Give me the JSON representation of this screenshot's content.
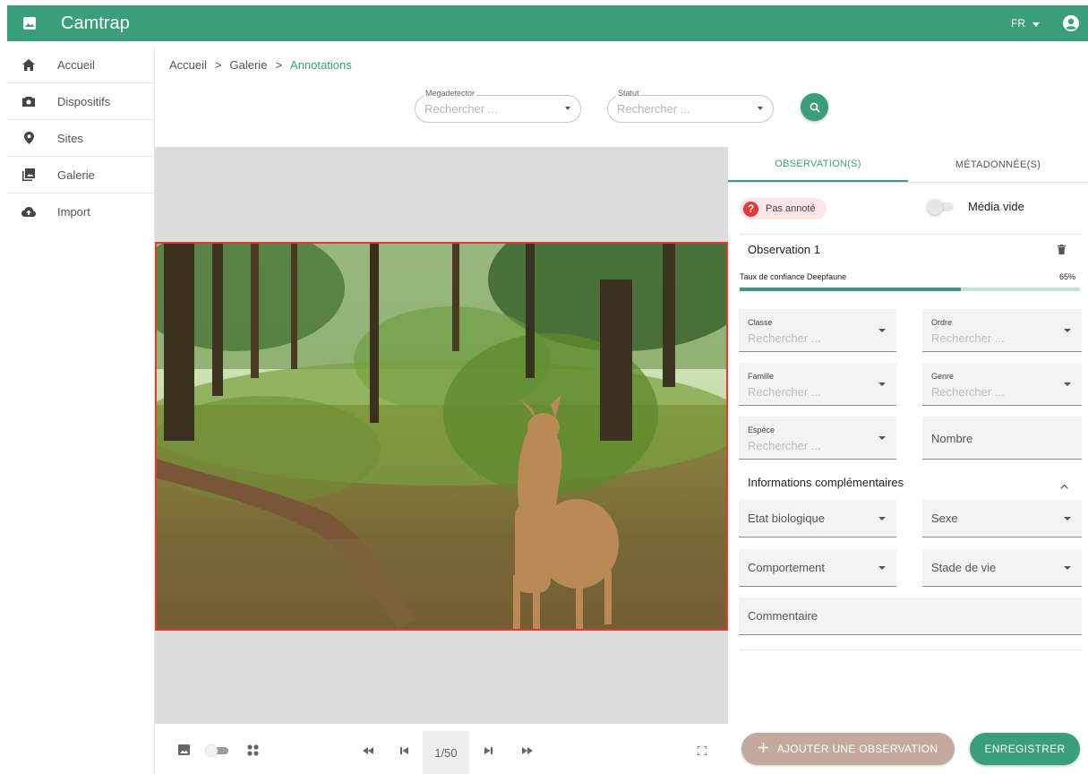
{
  "app": {
    "title": "Camtrap",
    "language": "FR"
  },
  "sidebar": {
    "items": [
      {
        "label": "Accueil",
        "icon": "home-icon"
      },
      {
        "label": "Dispositifs",
        "icon": "camera-icon"
      },
      {
        "label": "Sites",
        "icon": "location-pin-icon"
      },
      {
        "label": "Galerie",
        "icon": "photo-library-icon"
      },
      {
        "label": "Import",
        "icon": "cloud-upload-icon"
      }
    ]
  },
  "breadcrumb": {
    "items": [
      "Accueil",
      "Galerie",
      "Annotations"
    ],
    "separator": ">"
  },
  "filters": {
    "megadetector": {
      "label": "Megadetector",
      "placeholder": "Rechercher ..."
    },
    "statut": {
      "label": "Statut",
      "placeholder": "Rechercher ..."
    }
  },
  "viewer": {
    "page": "1/50"
  },
  "panel": {
    "tabs": [
      "OBSERVATION(S)",
      "MÉTADONNÉE(S)"
    ],
    "active_tab": 0,
    "status_chip": "Pas annoté",
    "empty_media_label": "Média vide",
    "empty_media_on": false,
    "observation": {
      "title": "Observation 1",
      "confidence_label": "Taux de confiance Deepfaune",
      "confidence_value": "65%",
      "confidence_fraction": 0.65,
      "fields": {
        "classe": {
          "label": "Classe",
          "placeholder": "Rechercher ..."
        },
        "ordre": {
          "label": "Ordre",
          "placeholder": "Rechercher ..."
        },
        "famille": {
          "label": "Famille",
          "placeholder": "Rechercher ..."
        },
        "genre": {
          "label": "Genre",
          "placeholder": "Rechercher ..."
        },
        "espece": {
          "label": "Espèce",
          "placeholder": "Rechercher ..."
        },
        "nombre": "Nombre"
      },
      "extra_title": "Informations complémentaires",
      "extra": {
        "etat": "Etat biologique",
        "sexe": "Sexe",
        "comportement": "Comportement",
        "stade": "Stade de vie",
        "commentaire": "Commentaire"
      }
    },
    "add_button": "AJOUTER UNE OBSERVATION",
    "save_button": "ENREGISTRER"
  },
  "colors": {
    "primary": "#3b9e7a",
    "error": "#e53935",
    "add_button": "#c4a99f"
  }
}
